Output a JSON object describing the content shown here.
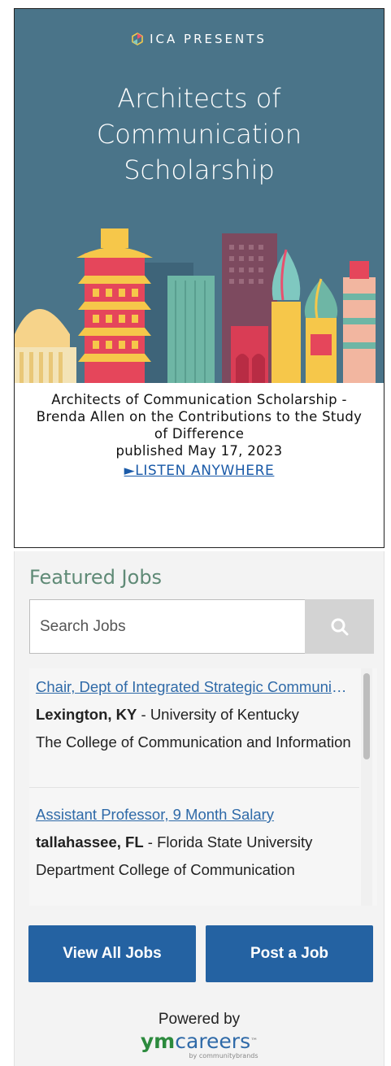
{
  "podcast": {
    "banner": {
      "brand": "ICA PRESENTS",
      "title_lines": [
        "Architects of",
        "Communication",
        "Scholarship"
      ]
    },
    "episode_title": "Architects of Communication Scholarship - Brenda Allen on the Contributions to the Study of Difference",
    "published": "published May 17, 2023",
    "listen_label": "►LISTEN ANYWHERE"
  },
  "jobs": {
    "heading": "Featured Jobs",
    "search": {
      "placeholder": "Search Jobs",
      "icon": "search-icon"
    },
    "items": [
      {
        "title": "Chair, Dept of Integrated Strategic Communication",
        "location": "Lexington, KY",
        "employer": " - University of Kentucky",
        "description": "The College of Communication and Information"
      },
      {
        "title": "Assistant Professor, 9 Month Salary",
        "location": "tallahassee, FL",
        "employer": " - Florida State University",
        "description": "Department College of Communication"
      }
    ],
    "buttons": {
      "view_all": "View All Jobs",
      "post": "Post a Job"
    },
    "powered_by": {
      "label": "Powered by",
      "logo_strong": "ym",
      "logo_rest": "careers",
      "logo_tm": "™",
      "tagline": "by communitybrands"
    }
  },
  "colors": {
    "banner_bg": "#4a7489",
    "job_title": "#2f6aa8",
    "button_bg": "#2462a2",
    "heading": "#5f8a76"
  }
}
